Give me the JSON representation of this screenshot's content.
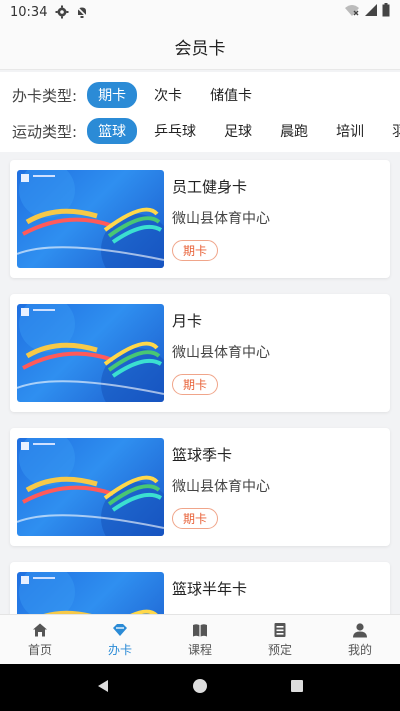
{
  "status_bar": {
    "time": "10:34"
  },
  "header": {
    "title": "会员卡"
  },
  "filters": {
    "card_type": {
      "label": "办卡类型:",
      "options": [
        "期卡",
        "次卡",
        "储值卡"
      ],
      "selected": "期卡"
    },
    "sport_type": {
      "label": "运动类型:",
      "options": [
        "篮球",
        "乒乓球",
        "足球",
        "晨跑",
        "培训",
        "羽"
      ],
      "selected": "篮球"
    }
  },
  "cards": [
    {
      "title": "员工健身卡",
      "venue": "微山县体育中心",
      "tag": "期卡"
    },
    {
      "title": "月卡",
      "venue": "微山县体育中心",
      "tag": "期卡"
    },
    {
      "title": "篮球季卡",
      "venue": "微山县体育中心",
      "tag": "期卡"
    },
    {
      "title": "篮球半年卡",
      "venue": "",
      "tag": ""
    }
  ],
  "bottom_nav": {
    "items": [
      {
        "label": "首页",
        "icon": "home-icon"
      },
      {
        "label": "办卡",
        "icon": "card-icon"
      },
      {
        "label": "课程",
        "icon": "book-icon"
      },
      {
        "label": "预定",
        "icon": "booking-icon"
      },
      {
        "label": "我的",
        "icon": "user-icon"
      }
    ],
    "active": "办卡"
  },
  "colors": {
    "accent": "#2b8bd6",
    "tag": "#e8633a"
  }
}
